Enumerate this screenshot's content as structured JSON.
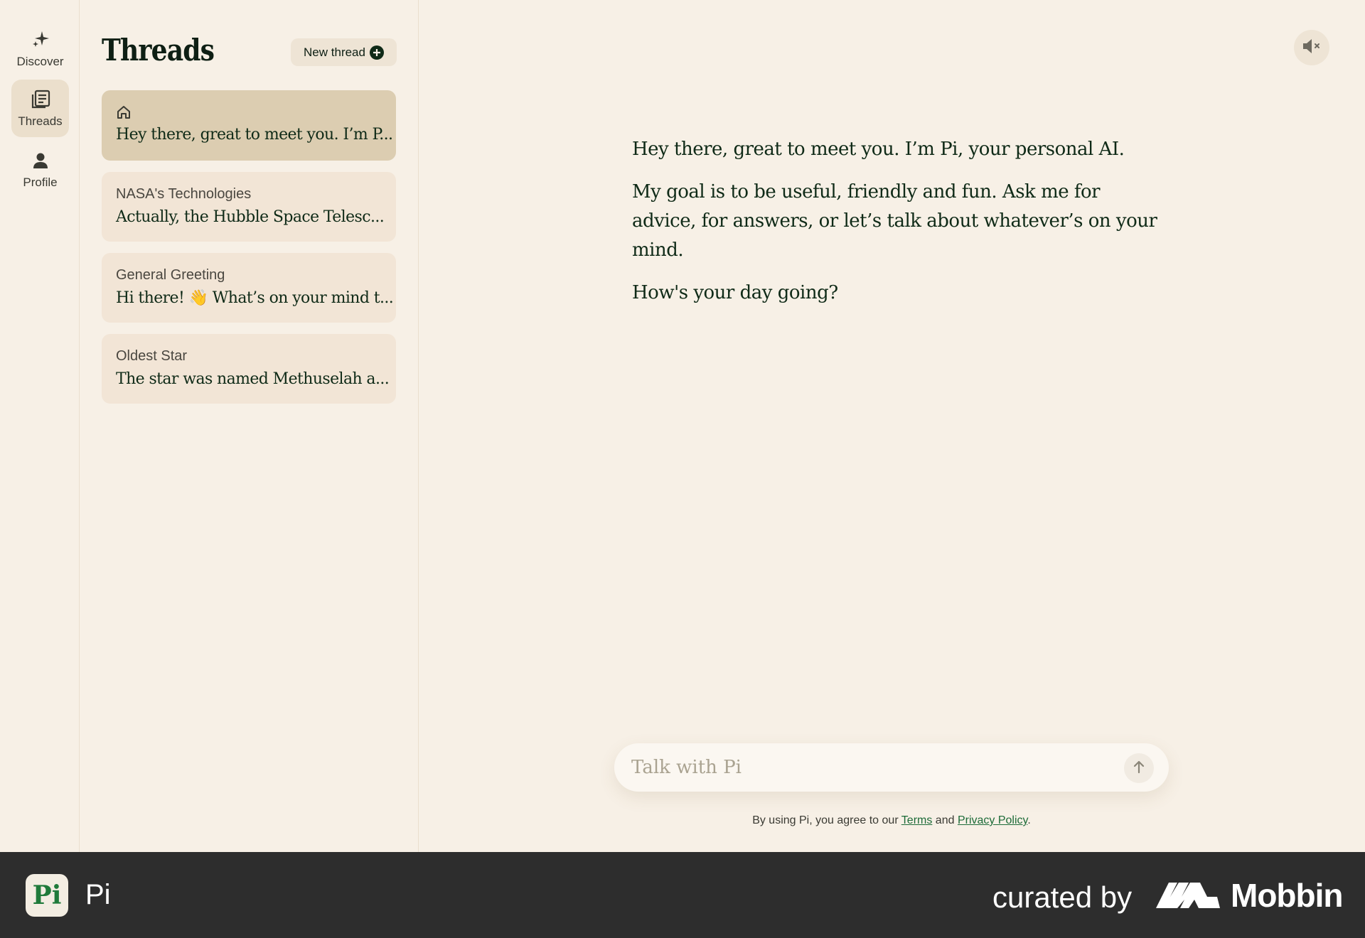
{
  "nav": {
    "items": [
      {
        "label": "Discover",
        "icon": "sparkle-icon"
      },
      {
        "label": "Threads",
        "icon": "threads-icon",
        "active": true
      },
      {
        "label": "Profile",
        "icon": "person-icon"
      }
    ]
  },
  "threads": {
    "title": "Threads",
    "new_thread_label": "New thread",
    "items": [
      {
        "title": "",
        "snippet": "Hey there, great to meet you. I’m P...",
        "icon": "home-icon",
        "active": true
      },
      {
        "title": "NASA's Technologies",
        "snippet": "Actually, the Hubble Space Telesc..."
      },
      {
        "title": "General Greeting",
        "snippet": "Hi there! 👋 What’s on your mind t..."
      },
      {
        "title": "Oldest Star",
        "snippet": "The star was named Methuselah a..."
      }
    ]
  },
  "chat": {
    "paragraphs": [
      "Hey there, great to meet you. I’m Pi, your personal AI.",
      "My goal is to be useful, friendly and fun. Ask me for advice, for answers, or let’s talk about whatever’s on your mind.",
      "How's your day going?"
    ],
    "input_placeholder": "Talk with Pi",
    "input_value": "",
    "legal_prefix": "By using Pi, you agree to our ",
    "terms_label": "Terms",
    "legal_and": " and ",
    "privacy_label": "Privacy Policy",
    "legal_suffix": "."
  },
  "banner": {
    "app_logo_text": "Pi",
    "app_name": "Pi",
    "curated_by": "curated by",
    "brand": "Mobbin"
  },
  "colors": {
    "background": "#f7f0e6",
    "accent_green": "#0f2a17",
    "active_card": "#dccdb1",
    "link_green": "#1d6b38",
    "banner": "#2d2d2d"
  }
}
